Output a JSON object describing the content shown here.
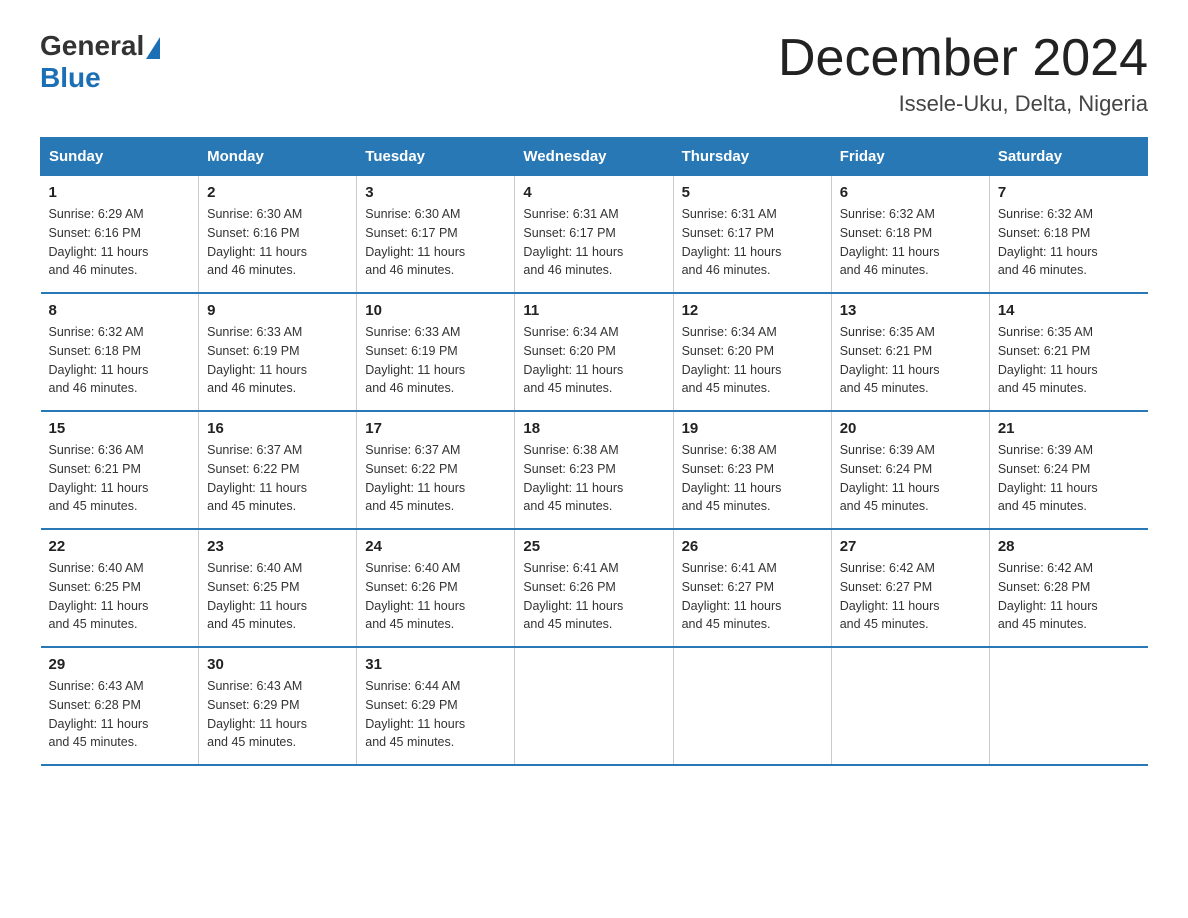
{
  "logo": {
    "general": "General",
    "blue": "Blue"
  },
  "title": "December 2024",
  "location": "Issele-Uku, Delta, Nigeria",
  "days_of_week": [
    "Sunday",
    "Monday",
    "Tuesday",
    "Wednesday",
    "Thursday",
    "Friday",
    "Saturday"
  ],
  "weeks": [
    [
      {
        "day": "1",
        "sunrise": "6:29 AM",
        "sunset": "6:16 PM",
        "daylight": "11 hours and 46 minutes."
      },
      {
        "day": "2",
        "sunrise": "6:30 AM",
        "sunset": "6:16 PM",
        "daylight": "11 hours and 46 minutes."
      },
      {
        "day": "3",
        "sunrise": "6:30 AM",
        "sunset": "6:17 PM",
        "daylight": "11 hours and 46 minutes."
      },
      {
        "day": "4",
        "sunrise": "6:31 AM",
        "sunset": "6:17 PM",
        "daylight": "11 hours and 46 minutes."
      },
      {
        "day": "5",
        "sunrise": "6:31 AM",
        "sunset": "6:17 PM",
        "daylight": "11 hours and 46 minutes."
      },
      {
        "day": "6",
        "sunrise": "6:32 AM",
        "sunset": "6:18 PM",
        "daylight": "11 hours and 46 minutes."
      },
      {
        "day": "7",
        "sunrise": "6:32 AM",
        "sunset": "6:18 PM",
        "daylight": "11 hours and 46 minutes."
      }
    ],
    [
      {
        "day": "8",
        "sunrise": "6:32 AM",
        "sunset": "6:18 PM",
        "daylight": "11 hours and 46 minutes."
      },
      {
        "day": "9",
        "sunrise": "6:33 AM",
        "sunset": "6:19 PM",
        "daylight": "11 hours and 46 minutes."
      },
      {
        "day": "10",
        "sunrise": "6:33 AM",
        "sunset": "6:19 PM",
        "daylight": "11 hours and 46 minutes."
      },
      {
        "day": "11",
        "sunrise": "6:34 AM",
        "sunset": "6:20 PM",
        "daylight": "11 hours and 45 minutes."
      },
      {
        "day": "12",
        "sunrise": "6:34 AM",
        "sunset": "6:20 PM",
        "daylight": "11 hours and 45 minutes."
      },
      {
        "day": "13",
        "sunrise": "6:35 AM",
        "sunset": "6:21 PM",
        "daylight": "11 hours and 45 minutes."
      },
      {
        "day": "14",
        "sunrise": "6:35 AM",
        "sunset": "6:21 PM",
        "daylight": "11 hours and 45 minutes."
      }
    ],
    [
      {
        "day": "15",
        "sunrise": "6:36 AM",
        "sunset": "6:21 PM",
        "daylight": "11 hours and 45 minutes."
      },
      {
        "day": "16",
        "sunrise": "6:37 AM",
        "sunset": "6:22 PM",
        "daylight": "11 hours and 45 minutes."
      },
      {
        "day": "17",
        "sunrise": "6:37 AM",
        "sunset": "6:22 PM",
        "daylight": "11 hours and 45 minutes."
      },
      {
        "day": "18",
        "sunrise": "6:38 AM",
        "sunset": "6:23 PM",
        "daylight": "11 hours and 45 minutes."
      },
      {
        "day": "19",
        "sunrise": "6:38 AM",
        "sunset": "6:23 PM",
        "daylight": "11 hours and 45 minutes."
      },
      {
        "day": "20",
        "sunrise": "6:39 AM",
        "sunset": "6:24 PM",
        "daylight": "11 hours and 45 minutes."
      },
      {
        "day": "21",
        "sunrise": "6:39 AM",
        "sunset": "6:24 PM",
        "daylight": "11 hours and 45 minutes."
      }
    ],
    [
      {
        "day": "22",
        "sunrise": "6:40 AM",
        "sunset": "6:25 PM",
        "daylight": "11 hours and 45 minutes."
      },
      {
        "day": "23",
        "sunrise": "6:40 AM",
        "sunset": "6:25 PM",
        "daylight": "11 hours and 45 minutes."
      },
      {
        "day": "24",
        "sunrise": "6:40 AM",
        "sunset": "6:26 PM",
        "daylight": "11 hours and 45 minutes."
      },
      {
        "day": "25",
        "sunrise": "6:41 AM",
        "sunset": "6:26 PM",
        "daylight": "11 hours and 45 minutes."
      },
      {
        "day": "26",
        "sunrise": "6:41 AM",
        "sunset": "6:27 PM",
        "daylight": "11 hours and 45 minutes."
      },
      {
        "day": "27",
        "sunrise": "6:42 AM",
        "sunset": "6:27 PM",
        "daylight": "11 hours and 45 minutes."
      },
      {
        "day": "28",
        "sunrise": "6:42 AM",
        "sunset": "6:28 PM",
        "daylight": "11 hours and 45 minutes."
      }
    ],
    [
      {
        "day": "29",
        "sunrise": "6:43 AM",
        "sunset": "6:28 PM",
        "daylight": "11 hours and 45 minutes."
      },
      {
        "day": "30",
        "sunrise": "6:43 AM",
        "sunset": "6:29 PM",
        "daylight": "11 hours and 45 minutes."
      },
      {
        "day": "31",
        "sunrise": "6:44 AM",
        "sunset": "6:29 PM",
        "daylight": "11 hours and 45 minutes."
      },
      null,
      null,
      null,
      null
    ]
  ],
  "labels": {
    "sunrise": "Sunrise:",
    "sunset": "Sunset:",
    "daylight": "Daylight:"
  }
}
